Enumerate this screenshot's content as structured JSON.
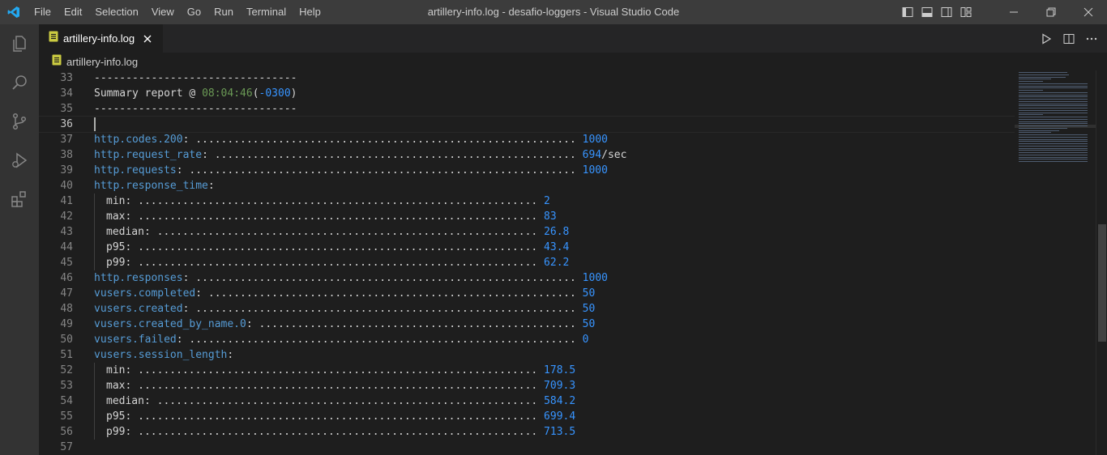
{
  "window": {
    "title": "artillery-info.log - desafio-loggers - Visual Studio Code"
  },
  "menu": [
    "File",
    "Edit",
    "Selection",
    "View",
    "Go",
    "Run",
    "Terminal",
    "Help"
  ],
  "tab": {
    "label": "artillery-info.log",
    "icon": "file-text-icon"
  },
  "breadcrumb": {
    "label": "artillery-info.log"
  },
  "editor": {
    "lines": [
      {
        "num": "33",
        "text": "--------------------------------"
      },
      {
        "num": "34",
        "prefix": "Summary report @ ",
        "time": "08:04:46",
        "open": "(",
        "tz": "-0300",
        "close": ")"
      },
      {
        "num": "35",
        "text": "--------------------------------"
      },
      {
        "num": "36",
        "text": ""
      },
      {
        "num": "37",
        "key": "http.codes.200",
        "dots": ": ............................................................ ",
        "value": "1000"
      },
      {
        "num": "38",
        "key": "http.request_rate",
        "dots": ": ......................................................... ",
        "value": "694",
        "suffix": "/sec"
      },
      {
        "num": "39",
        "key": "http.requests",
        "dots": ": ............................................................. ",
        "value": "1000"
      },
      {
        "num": "40",
        "key": "http.response_time",
        "dots": ":",
        "value": ""
      },
      {
        "num": "41",
        "indent": true,
        "key": "min",
        "dots": ": ............................................................... ",
        "value": "2"
      },
      {
        "num": "42",
        "indent": true,
        "key": "max",
        "dots": ": ............................................................... ",
        "value": "83"
      },
      {
        "num": "43",
        "indent": true,
        "key": "median",
        "dots": ": ............................................................ ",
        "value": "26.8"
      },
      {
        "num": "44",
        "indent": true,
        "key": "p95",
        "dots": ": ............................................................... ",
        "value": "43.4"
      },
      {
        "num": "45",
        "indent": true,
        "key": "p99",
        "dots": ": ............................................................... ",
        "value": "62.2"
      },
      {
        "num": "46",
        "key": "http.responses",
        "dots": ": ............................................................ ",
        "value": "1000"
      },
      {
        "num": "47",
        "key": "vusers.completed",
        "dots": ": .......................................................... ",
        "value": "50"
      },
      {
        "num": "48",
        "key": "vusers.created",
        "dots": ": ............................................................ ",
        "value": "50"
      },
      {
        "num": "49",
        "key": "vusers.created_by_name.0",
        "dots": ": .................................................. ",
        "value": "50"
      },
      {
        "num": "50",
        "key": "vusers.failed",
        "dots": ": ............................................................. ",
        "value": "0"
      },
      {
        "num": "51",
        "key": "vusers.session_length",
        "dots": ":",
        "value": ""
      },
      {
        "num": "52",
        "indent": true,
        "key": "min",
        "dots": ": ............................................................... ",
        "value": "178.5"
      },
      {
        "num": "53",
        "indent": true,
        "key": "max",
        "dots": ": ............................................................... ",
        "value": "709.3"
      },
      {
        "num": "54",
        "indent": true,
        "key": "median",
        "dots": ": ............................................................ ",
        "value": "584.2"
      },
      {
        "num": "55",
        "indent": true,
        "key": "p95",
        "dots": ": ............................................................... ",
        "value": "699.4"
      },
      {
        "num": "56",
        "indent": true,
        "key": "p99",
        "dots": ": ............................................................... ",
        "value": "713.5"
      },
      {
        "num": "57",
        "text": ""
      }
    ],
    "current_line": "36"
  },
  "colors": {
    "accent": "#007acc",
    "key": "#569cd6",
    "value": "#3794ff",
    "time": "#6a9955"
  }
}
